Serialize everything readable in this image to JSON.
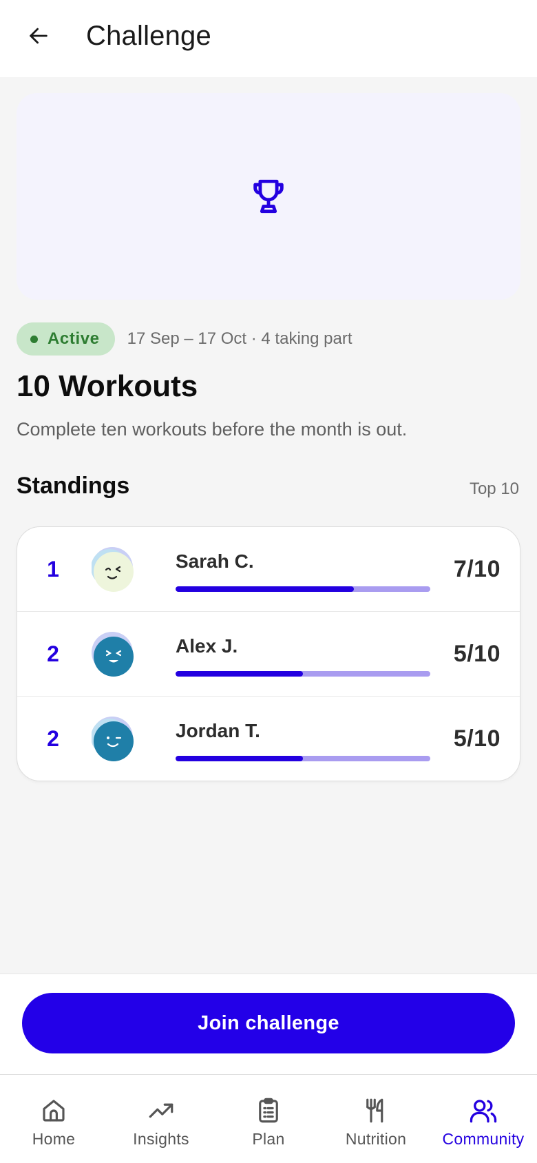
{
  "header": {
    "title": "Challenge",
    "back_icon": "arrow-left-icon"
  },
  "hero": {
    "icon": "trophy-icon",
    "background_color": "#f4f3fd",
    "icon_color": "#2300e0"
  },
  "challenge": {
    "status": "Active",
    "meta": "17 Sep – 17 Oct · 4 taking part",
    "title": "10 Workouts",
    "description": "Complete ten workouts before the month is out."
  },
  "standings": {
    "title": "Standings",
    "tag": "Top 10",
    "entries": [
      {
        "rank": "1",
        "name": "Sarah C.",
        "score": "7/10",
        "progress": 0.7,
        "avatar_color": "#eef5dc"
      },
      {
        "rank": "2",
        "name": "Alex J.",
        "score": "5/10",
        "progress": 0.5,
        "avatar_color": "#1f7fa8"
      },
      {
        "rank": "2",
        "name": "Jordan T.",
        "score": "5/10",
        "progress": 0.5,
        "avatar_color": "#1f7fa8"
      }
    ]
  },
  "cta": {
    "label": "Join challenge"
  },
  "nav": {
    "items": [
      {
        "label": "Home",
        "icon": "home-icon",
        "active": false
      },
      {
        "label": "Insights",
        "icon": "trending-up-icon",
        "active": false
      },
      {
        "label": "Plan",
        "icon": "clipboard-icon",
        "active": false
      },
      {
        "label": "Nutrition",
        "icon": "utensils-icon",
        "active": false
      },
      {
        "label": "Community",
        "icon": "users-icon",
        "active": true
      }
    ]
  },
  "colors": {
    "accent": "#2300e0",
    "status_green": "#2e7d32",
    "status_bg": "#c8e6c9",
    "progress_track": "#a99cf0"
  }
}
